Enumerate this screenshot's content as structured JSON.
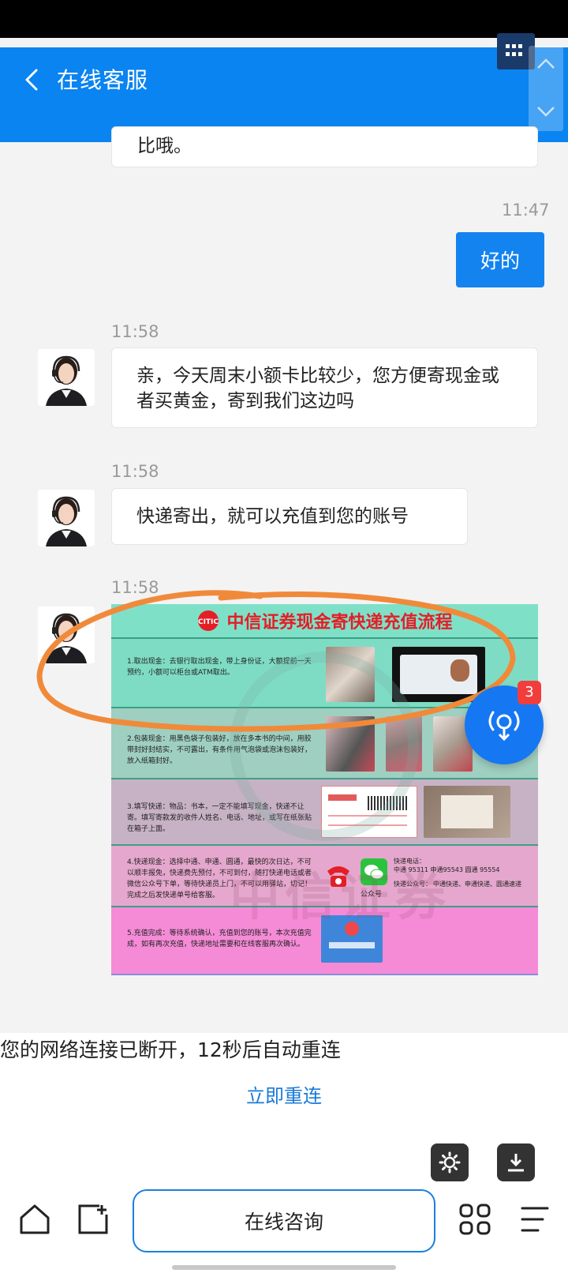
{
  "header": {
    "title": "在线客服"
  },
  "chat": {
    "partial_text": "比哦。",
    "my_time": "11:47",
    "my_message": "好的",
    "messages": [
      {
        "time": "11:58",
        "text": "亲，今天周末小额卡比较少，您方便寄现金或者买黄金，寄到我们这边吗"
      },
      {
        "time": "11:58",
        "text": "快递寄出，就可以充值到您的账号"
      },
      {
        "time": "11:58"
      }
    ]
  },
  "promo": {
    "title": "中信证券现金寄快递充值流程",
    "steps": [
      "1.取出现金：去银行取出现金，带上身份证，大额提前一天预约，小额可以柜台或ATM取出。",
      "2.包装现金：用黑色袋子包装好，放在多本书的中间，用胶带封好封结实，不可露出，有条件用气泡袋或泡沫包装好，放入纸箱封好。",
      "3.填写快递：物品：书本，一定不能填写现金，快递不让寄。填写寄款发的收件人姓名、电话、地址，或写在纸张贴在箱子上面。",
      "4.快递现金：选择中通、申通、圆通，最快的次日达，不可以顺丰报免，快递费先预付，不可到付，随打快递电话或者微信公众号下单，等待快递员上门，不可以用驿站，切记！完成之后发快递单号给客服。",
      "5.充值完成：等待系统确认，充值到您的账号，本次充值完成，如有再次充值，快递地址需要和在线客服再次确认。"
    ],
    "hotline_title": "快递电话：",
    "hotlines": "中通 95311    申通95543    圆通 95554",
    "wechat_title": "快递公众号：",
    "wechat_names": "中通快递、申通快递、圆通速递",
    "wechat_label": "公众号",
    "watermark": "中信证券"
  },
  "float_badge": "3",
  "network": {
    "message": "您的网络连接已断开，12秒后自动重连",
    "reconnect_label": "立即重连"
  },
  "bottom": {
    "consult_label": "在线咨询"
  },
  "colors": {
    "primary": "#0a84f0",
    "link": "#1a7ad8",
    "badge": "#f23d3d",
    "annotation": "#f08a3a"
  }
}
